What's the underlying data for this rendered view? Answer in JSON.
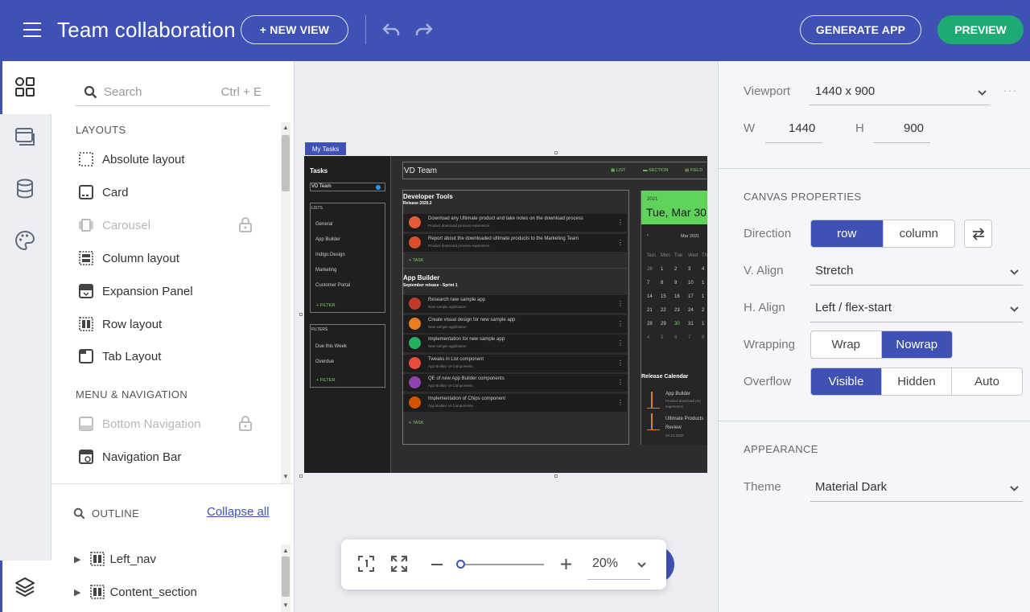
{
  "header": {
    "title": "Team collaboration",
    "new_view": "+ NEW VIEW",
    "generate_app": "GENERATE APP",
    "preview": "PREVIEW"
  },
  "toolbox": {
    "search_placeholder": "Search",
    "search_shortcut": "Ctrl + E",
    "sections": [
      {
        "title": "LAYOUTS",
        "items": [
          {
            "label": "Absolute layout",
            "icon": "absolute-layout-icon",
            "locked": false
          },
          {
            "label": "Card",
            "icon": "card-icon",
            "locked": false
          },
          {
            "label": "Carousel",
            "icon": "carousel-icon",
            "locked": true
          },
          {
            "label": "Column layout",
            "icon": "column-layout-icon",
            "locked": false
          },
          {
            "label": "Expansion Panel",
            "icon": "expansion-panel-icon",
            "locked": false
          },
          {
            "label": "Row layout",
            "icon": "row-layout-icon",
            "locked": false
          },
          {
            "label": "Tab Layout",
            "icon": "tab-layout-icon",
            "locked": false
          }
        ]
      },
      {
        "title": "MENU & NAVIGATION",
        "items": [
          {
            "label": "Bottom Navigation",
            "icon": "bottom-navigation-icon",
            "locked": true
          },
          {
            "label": "Navigation Bar",
            "icon": "navigation-bar-icon",
            "locked": false
          }
        ]
      }
    ]
  },
  "outline": {
    "title": "OUTLINE",
    "collapse_all": "Collapse all",
    "items": [
      "Left_nav",
      "Content_section"
    ]
  },
  "canvas": {
    "tag": "My Tasks",
    "mock": {
      "nav_title": "Tasks",
      "team_select": "VD Team",
      "lists_header": "LISTS",
      "lists": [
        "General",
        "App Builder",
        "Indigo.Design",
        "Marketing",
        "Customer Portal"
      ],
      "filter": "FILTER",
      "filters_header": "FILTERS",
      "filters": [
        "Due this Week",
        "Overdue"
      ],
      "team_title": "VD Team",
      "tabs": [
        "LIST",
        "SECTION",
        "FIELD"
      ],
      "groups": [
        {
          "title": "Developer Tools",
          "sub": "Release 2020.2",
          "tasks": [
            {
              "title": "Download any Ultimate product and take notes on the download process",
              "sub": "Product download process experience"
            },
            {
              "title": "Report about the downloaded ultimate products to the Marketing Team",
              "sub": "Product download process experience"
            }
          ]
        },
        {
          "title": "App Builder",
          "sub": "September release - Sprint 1",
          "tasks": [
            {
              "title": "Research new sample app",
              "sub": "New sample application"
            },
            {
              "title": "Create visual design for new sample app",
              "sub": "New sample application"
            },
            {
              "title": "Implementation for new sample app",
              "sub": "New sample application"
            },
            {
              "title": "Tweaks in List component",
              "sub": "App Builder UI Components"
            },
            {
              "title": "QE of new App Builder components",
              "sub": "App Builder UI Components"
            },
            {
              "title": "Implementation of Chips component",
              "sub": "App Builder UI Components"
            }
          ]
        }
      ],
      "add_task": "TASK",
      "calendar": {
        "year": "2021",
        "date": "Tue, Mar 30",
        "month": "Mar 2021",
        "weekdays": [
          "Sun",
          "Mon",
          "Tue",
          "Wed",
          "Th"
        ],
        "weeks": [
          [
            "28",
            "1",
            "2",
            "3",
            "4"
          ],
          [
            "7",
            "8",
            "9",
            "10",
            "1"
          ],
          [
            "14",
            "15",
            "16",
            "17",
            "1"
          ],
          [
            "21",
            "22",
            "23",
            "24",
            "2"
          ],
          [
            "28",
            "29",
            "30",
            "31",
            "1"
          ],
          [
            "4",
            "5",
            "6",
            "7",
            "8"
          ]
        ]
      },
      "release_title": "Release Calendar",
      "releases": [
        {
          "title": "App Builder",
          "sub": "Product download pro",
          "sub2": "experience"
        },
        {
          "title": "Ultimate Products",
          "sub": "Review",
          "sub2": "08.13.2020"
        }
      ]
    }
  },
  "zoom": {
    "value": "20%",
    "level": 0.0
  },
  "props": {
    "viewport_label": "Viewport",
    "viewport_value": "1440 x 900",
    "w_label": "W",
    "w_value": "1440",
    "h_label": "H",
    "h_value": "900",
    "canvas_title": "CANVAS PROPERTIES",
    "direction_label": "Direction",
    "direction_options": [
      "row",
      "column"
    ],
    "valign_label": "V. Align",
    "valign_value": "Stretch",
    "halign_label": "H. Align",
    "halign_value": "Left / flex-start",
    "wrapping_label": "Wrapping",
    "wrapping_options": [
      "Wrap",
      "Nowrap"
    ],
    "overflow_label": "Overflow",
    "overflow_options": [
      "Visible",
      "Hidden",
      "Auto"
    ],
    "appearance_title": "APPEARANCE",
    "theme_label": "Theme",
    "theme_value": "Material Dark"
  },
  "colors": {
    "primary": "#3f51b5",
    "preview": "#1eab73",
    "calendar_header": "#5fd35a",
    "mock_accent": "#7ad36b"
  }
}
